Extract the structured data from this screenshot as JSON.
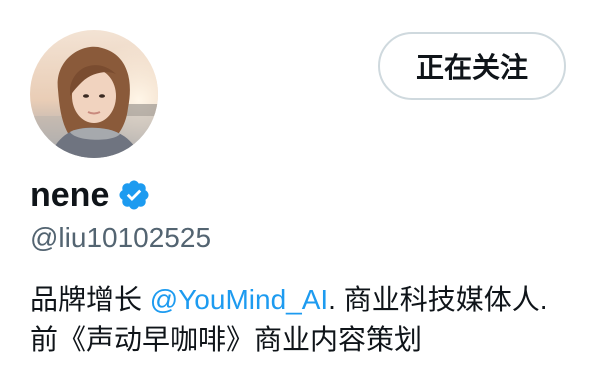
{
  "profile": {
    "display_name": "nene",
    "handle": "@liu10102525",
    "verified": true,
    "follow_button_label": "正在关注",
    "bio": {
      "part1": "品牌增长 ",
      "mention": "@YouMind_AI",
      "part2": ". 商业科技媒体人. 前《声动早咖啡》商业内容策划"
    }
  },
  "colors": {
    "text_primary": "#0f1419",
    "text_secondary": "#536471",
    "link": "#1d9bf0",
    "verified_badge": "#1d9bf0",
    "button_border": "#cfd9de"
  },
  "icons": {
    "avatar": "profile-photo",
    "verified": "verified-badge-icon"
  }
}
